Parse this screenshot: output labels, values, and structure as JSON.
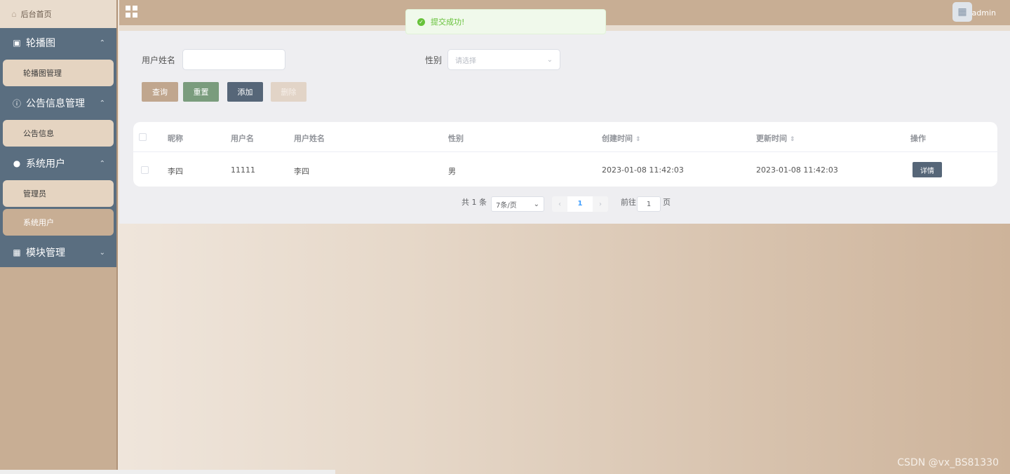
{
  "sidebar": {
    "home": "后台首页",
    "groups": [
      {
        "title": "轮播图",
        "icon": "image-icon",
        "expanded": true,
        "items": [
          {
            "label": "轮播图管理"
          }
        ]
      },
      {
        "title": "公告信息管理",
        "icon": "info-icon",
        "expanded": true,
        "items": [
          {
            "label": "公告信息"
          }
        ]
      },
      {
        "title": "系统用户",
        "icon": "user-icon",
        "expanded": true,
        "items": [
          {
            "label": "管理员"
          },
          {
            "label": "系统用户"
          }
        ]
      },
      {
        "title": "模块管理",
        "icon": "grid-icon",
        "expanded": false,
        "items": []
      }
    ]
  },
  "header": {
    "title": "",
    "username": "admin"
  },
  "toast": {
    "message": "提交成功!"
  },
  "search": {
    "name_label": "用户姓名",
    "name_value": "",
    "gender_label": "性别",
    "gender_placeholder": "请选择"
  },
  "buttons": {
    "query": "查询",
    "reset": "重置",
    "add": "添加",
    "delete": "删除"
  },
  "table": {
    "headers": [
      "昵称",
      "用户名",
      "用户姓名",
      "性别",
      "创建时间",
      "更新时间",
      "操作"
    ],
    "rows": [
      {
        "nickname": "李四",
        "username": "11111",
        "realname": "李四",
        "gender": "男",
        "created": "2023-01-08 11:42:03",
        "updated": "2023-01-08 11:42:03",
        "action": "详情"
      }
    ]
  },
  "pagination": {
    "total_text": "共 1 条",
    "page_size": "7条/页",
    "current_page": "1",
    "goto_prefix": "前往",
    "goto_value": "1",
    "goto_suffix": "页"
  },
  "watermark": "CSDN @vx_BS81330",
  "colors": {
    "sidebar_header": "#5a6e80",
    "accent_tan": "#c8ae94",
    "success": "#67c23a"
  }
}
